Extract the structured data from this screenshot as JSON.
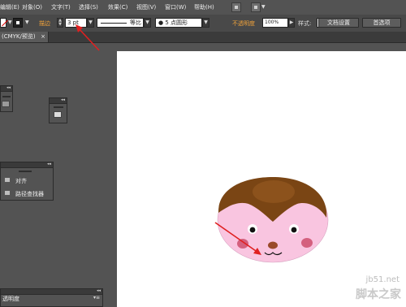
{
  "menubar": {
    "items": [
      {
        "label": "编辑(E)"
      },
      {
        "label": "对象(O)"
      },
      {
        "label": "文字(T)"
      },
      {
        "label": "选择(S)"
      },
      {
        "label": "效果(C)"
      },
      {
        "label": "视图(V)"
      },
      {
        "label": "窗口(W)"
      },
      {
        "label": "帮助(H)"
      }
    ]
  },
  "control_bar": {
    "stroke_label": "描边",
    "stroke_weight_value": "3 pt",
    "stroke_profile_label": "等比",
    "brush_definition": "● 5 点圆形",
    "opacity_label": "不透明度",
    "opacity_value": "100%",
    "style_label": "样式:",
    "document_setup_label": "文档设置",
    "preferences_label": "首选项"
  },
  "document_tab": {
    "label": "(CMYK/预览)",
    "close": "×"
  },
  "panels": {
    "align_label": "对齐",
    "pathfinder_label": "路径查找器",
    "bottom_panel_label": "透明度"
  },
  "watermark": {
    "site": "jb51.net",
    "brand": "脚本之家"
  },
  "colors": {
    "face_pink": "#f9c5e0",
    "hair_brown": "#7a4514",
    "cheek": "#d4607e",
    "nose": "#9a4a2a",
    "annotation_red": "#e02020",
    "orange_label": "#f0a23a"
  }
}
